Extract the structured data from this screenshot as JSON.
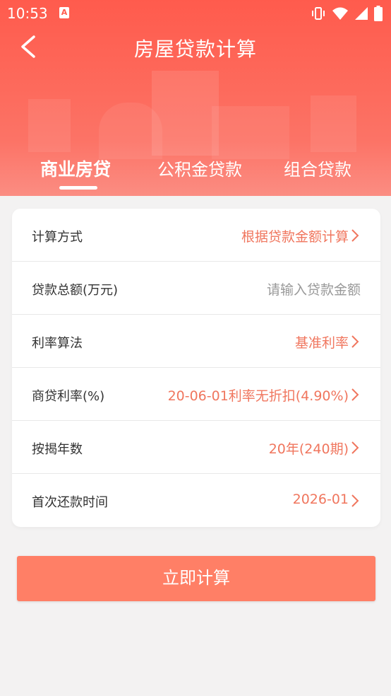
{
  "status_bar": {
    "time": "10:53",
    "app_icon": "A"
  },
  "header": {
    "title": "房屋贷款计算",
    "back_icon": "chevron-left-icon"
  },
  "tabs": [
    {
      "label": "商业房贷",
      "active": true
    },
    {
      "label": "公积金贷款",
      "active": false
    },
    {
      "label": "组合贷款",
      "active": false
    }
  ],
  "form": {
    "rows": [
      {
        "label": "计算方式",
        "value": "根据贷款金额计算",
        "arrow": true
      },
      {
        "label": "贷款总额(万元)",
        "placeholder": "请输入贷款金额",
        "arrow": false
      },
      {
        "label": "利率算法",
        "value": "基准利率",
        "arrow": true
      },
      {
        "label": "商贷利率(%)",
        "value": "20-06-01利率无折扣(4.90%)",
        "arrow": true
      },
      {
        "label": "按揭年数",
        "value": "20年(240期)",
        "arrow": true
      },
      {
        "label": "首次还款时间",
        "value": "2026-01",
        "arrow": true
      }
    ]
  },
  "action": {
    "calculate_label": "立即计算"
  },
  "colors": {
    "header": "#ff5b4d",
    "accent": "#f0765e",
    "button": "#ff7f66",
    "background": "#f3f2f2"
  }
}
